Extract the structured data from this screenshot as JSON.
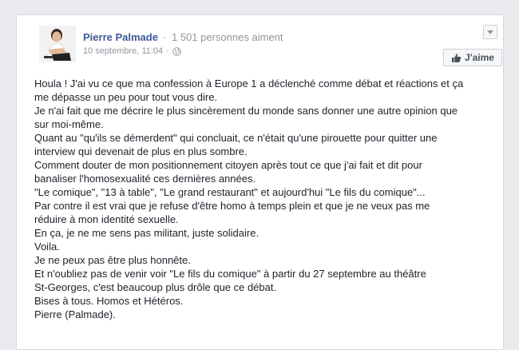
{
  "post": {
    "author": "Pierre Palmade",
    "separator": "·",
    "likes": "1 501 personnes aiment",
    "timestamp": "10 septembre, 11:04",
    "timestamp_separator": "·",
    "like_button_label": "J'aime",
    "privacy_icon": "globe-icon",
    "menu_icon": "chevron-down-icon",
    "lines": [
      "Houla ! J'ai vu ce que ma confession à Europe 1 a déclenché comme débat et réactions et ça",
      "me dépasse un peu pour tout vous dire.",
      "Je n'ai fait que me décrire le plus sincèrement du monde sans donner une autre opinion que",
      "sur moi-même.",
      "Quant au \"qu'ils se démerdent\" qui concluait, ce n'était qu'une pirouette pour quitter une",
      "interview qui devenait de plus en plus sombre.",
      "Comment douter de mon positionnement citoyen après tout ce que j'ai fait et dit pour",
      "banaliser l'homosexualité ces dernières années.",
      "\"Le comique\", \"13 à table\", \"Le grand restaurant\" et aujourd'hui \"Le fils du comique\"...",
      "Par contre il est vrai que je refuse d'être homo à temps plein et que je ne veux pas me",
      "réduire à mon identité sexuelle.",
      "En ça, je ne me sens pas militant, juste solidaire.",
      "Voila.",
      "Je ne peux pas être plus honnête.",
      "Et n'oubliez pas de venir voir \"Le fils du comique\" à partir du 27 septembre au théâtre",
      "St-Georges, c'est beaucoup plus drôle que ce débat.",
      "Bises à tous. Homos et Hétéros.",
      "Pierre (Palmade)."
    ]
  },
  "colors": {
    "link": "#3b5998",
    "meta": "#90949c",
    "text": "#1d2129"
  }
}
